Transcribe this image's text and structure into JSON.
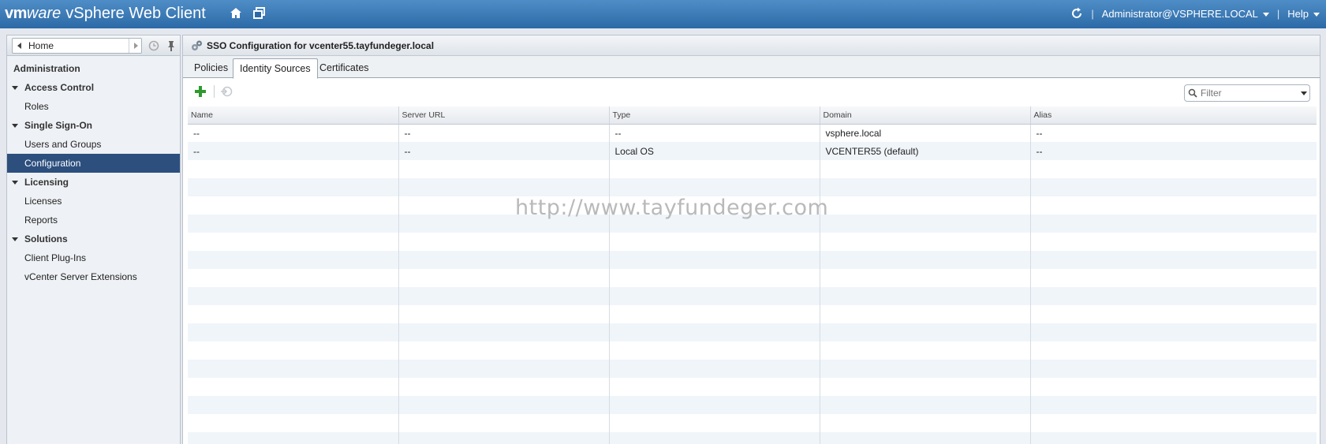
{
  "app": {
    "brand_vm": "vm",
    "brand_ware": "ware",
    "title": "vSphere Web Client",
    "user": "Administrator@VSPHERE.LOCAL",
    "help": "Help",
    "separator": "|"
  },
  "nav": {
    "home_label": "Home",
    "section": "Administration",
    "groups": [
      {
        "label": "Access Control",
        "items": [
          "Roles"
        ]
      },
      {
        "label": "Single Sign-On",
        "items": [
          "Users and Groups",
          "Configuration"
        ]
      },
      {
        "label": "Licensing",
        "items": [
          "Licenses",
          "Reports"
        ]
      },
      {
        "label": "Solutions",
        "items": [
          "Client Plug-Ins",
          "vCenter Server Extensions"
        ]
      }
    ],
    "selected": "Configuration"
  },
  "main": {
    "title": "SSO Configuration for vcenter55.tayfundeger.local",
    "tabs": [
      {
        "label": "Policies"
      },
      {
        "label": "Identity Sources",
        "active": true
      },
      {
        "label": "Certificates"
      }
    ],
    "filter_placeholder": "Filter",
    "table": {
      "columns": [
        "Name",
        "Server URL",
        "Type",
        "Domain",
        "Alias"
      ],
      "rows": [
        [
          "--",
          "--",
          "--",
          "vsphere.local",
          "--"
        ],
        [
          "--",
          "--",
          "Local OS",
          "VCENTER55 (default)",
          "--"
        ]
      ]
    },
    "watermark": "http://www.tayfundeger.com"
  },
  "colors": {
    "topbar": "#2c6aa7",
    "selected": "#2c4f7e",
    "add_green": "#2e9a2e"
  }
}
